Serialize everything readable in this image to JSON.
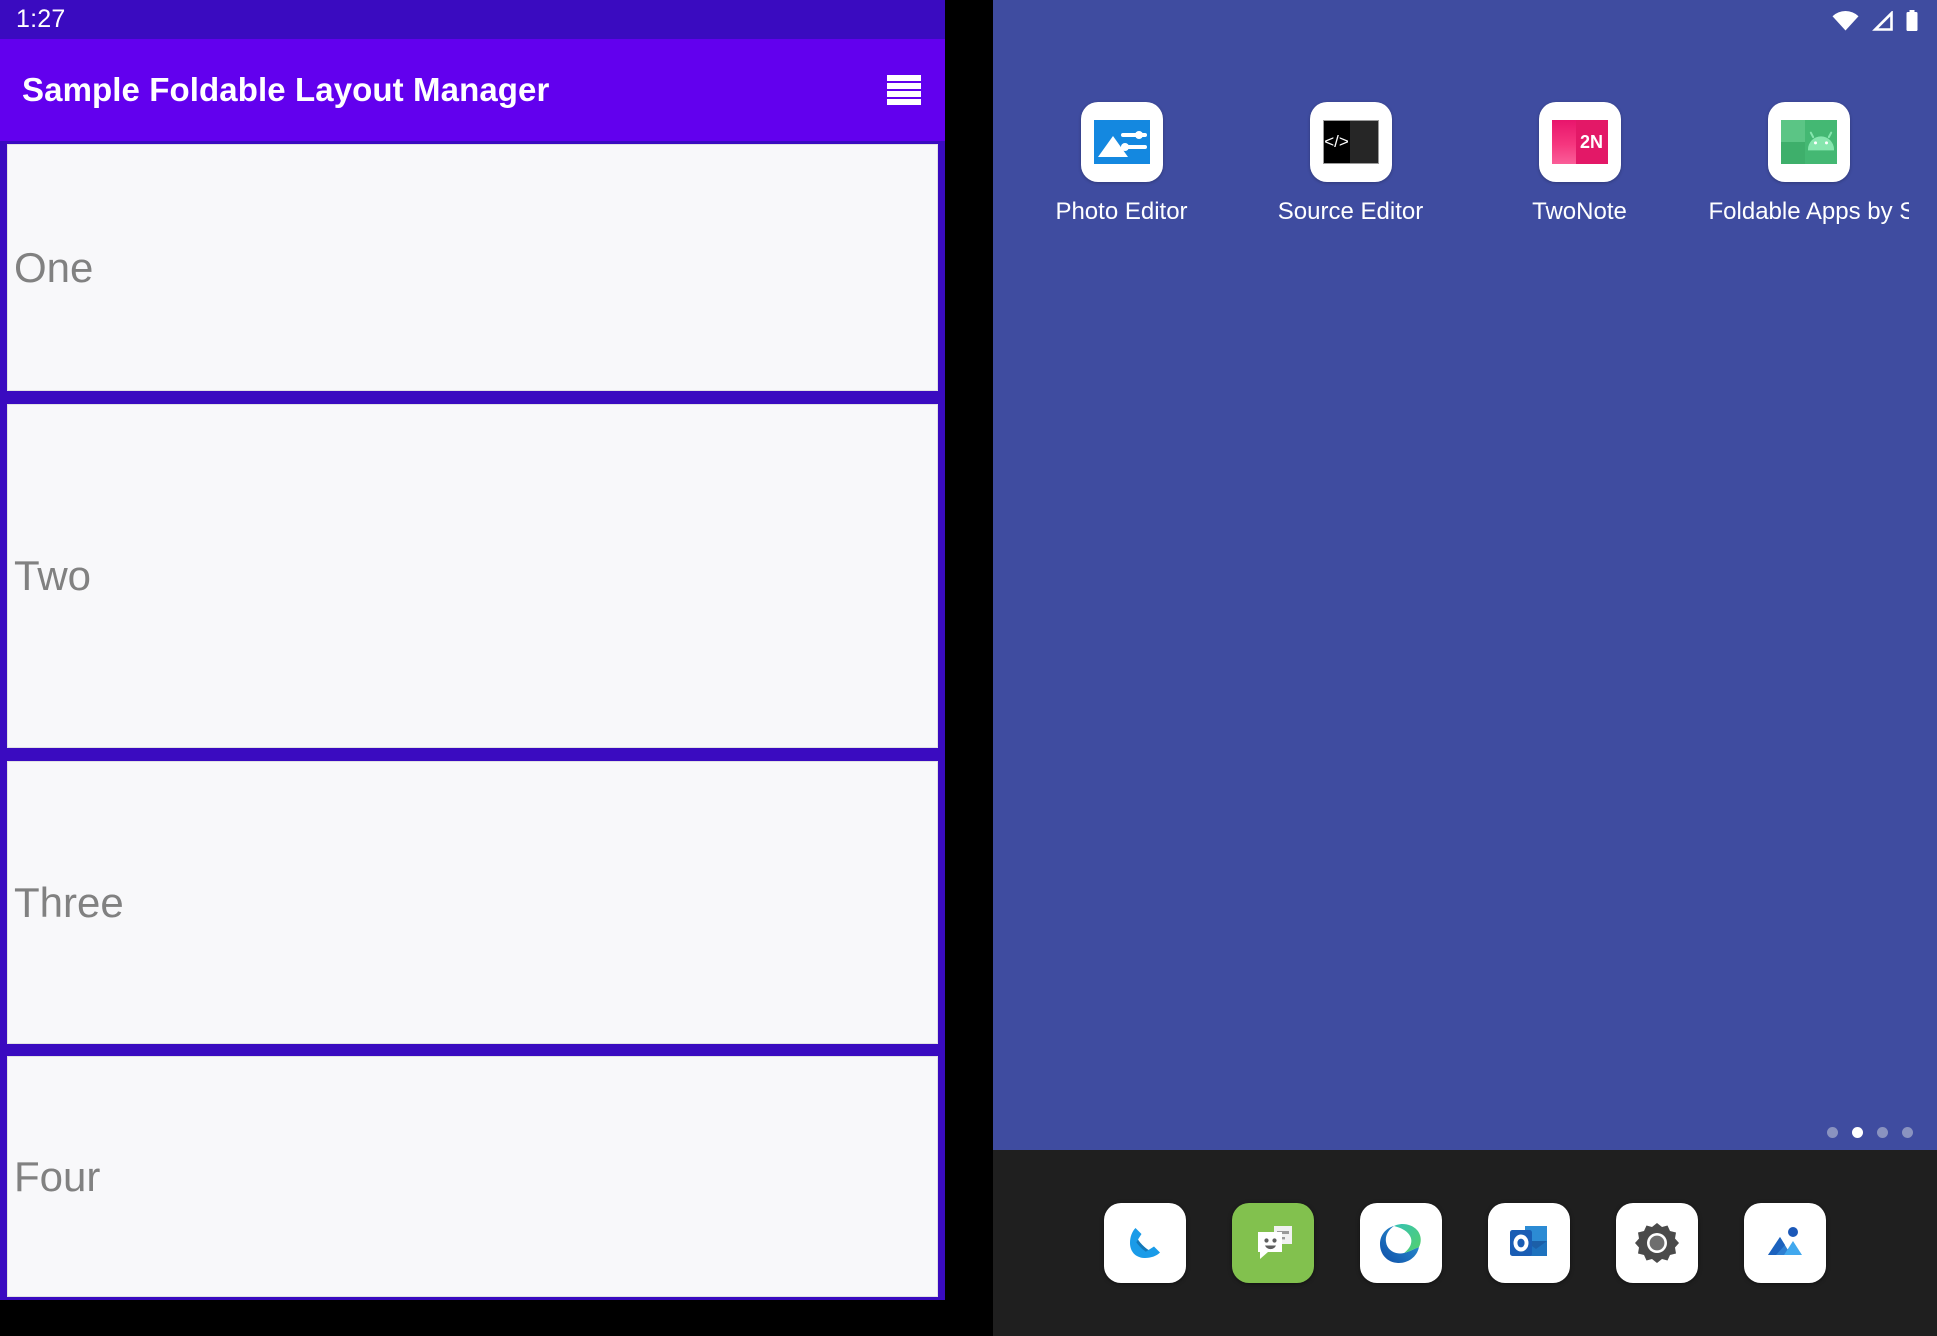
{
  "left_device": {
    "status_bar": {
      "time": "1:27"
    },
    "app_bar": {
      "title": "Sample Foldable Layout Manager",
      "menu_icon": "hamburger-menu-icon"
    },
    "cards": [
      {
        "label": "One"
      },
      {
        "label": "Two"
      },
      {
        "label": "Three"
      },
      {
        "label": "Four"
      }
    ],
    "nav": {
      "gesture_pill": "home-gesture-pill"
    },
    "colors": {
      "app_bar": "#6200EE",
      "status_bar": "#3A0BC0",
      "list_background": "#3A0BC0",
      "card_background": "#F8F8FA",
      "card_text": "#818181"
    }
  },
  "right_device": {
    "status_bar": {
      "icons": [
        "wifi-icon",
        "cellular-signal-icon",
        "battery-icon"
      ]
    },
    "home_screen": {
      "wallpaper_color": "#3F4CA0",
      "apps": [
        {
          "label": "Photo Editor",
          "icon": "photo-editor-icon"
        },
        {
          "label": "Source Editor",
          "icon": "source-editor-icon"
        },
        {
          "label": "TwoNote",
          "icon": "twonote-icon",
          "badge_text": "2N"
        },
        {
          "label": "Foldable Apps by S...",
          "icon": "foldable-apps-android-icon"
        }
      ],
      "source_editor_glyph": "</>",
      "page_indicator": {
        "count": 4,
        "active_index": 1
      }
    },
    "dock": {
      "background_color": "#1F1F1F",
      "items": [
        {
          "name": "phone-app",
          "icon": "phone-icon"
        },
        {
          "name": "messages-app",
          "icon": "messages-icon"
        },
        {
          "name": "edge-app",
          "icon": "edge-browser-icon"
        },
        {
          "name": "outlook-app",
          "icon": "outlook-icon"
        },
        {
          "name": "settings-app",
          "icon": "gear-icon"
        },
        {
          "name": "photos-app",
          "icon": "photos-gallery-icon"
        }
      ]
    }
  }
}
